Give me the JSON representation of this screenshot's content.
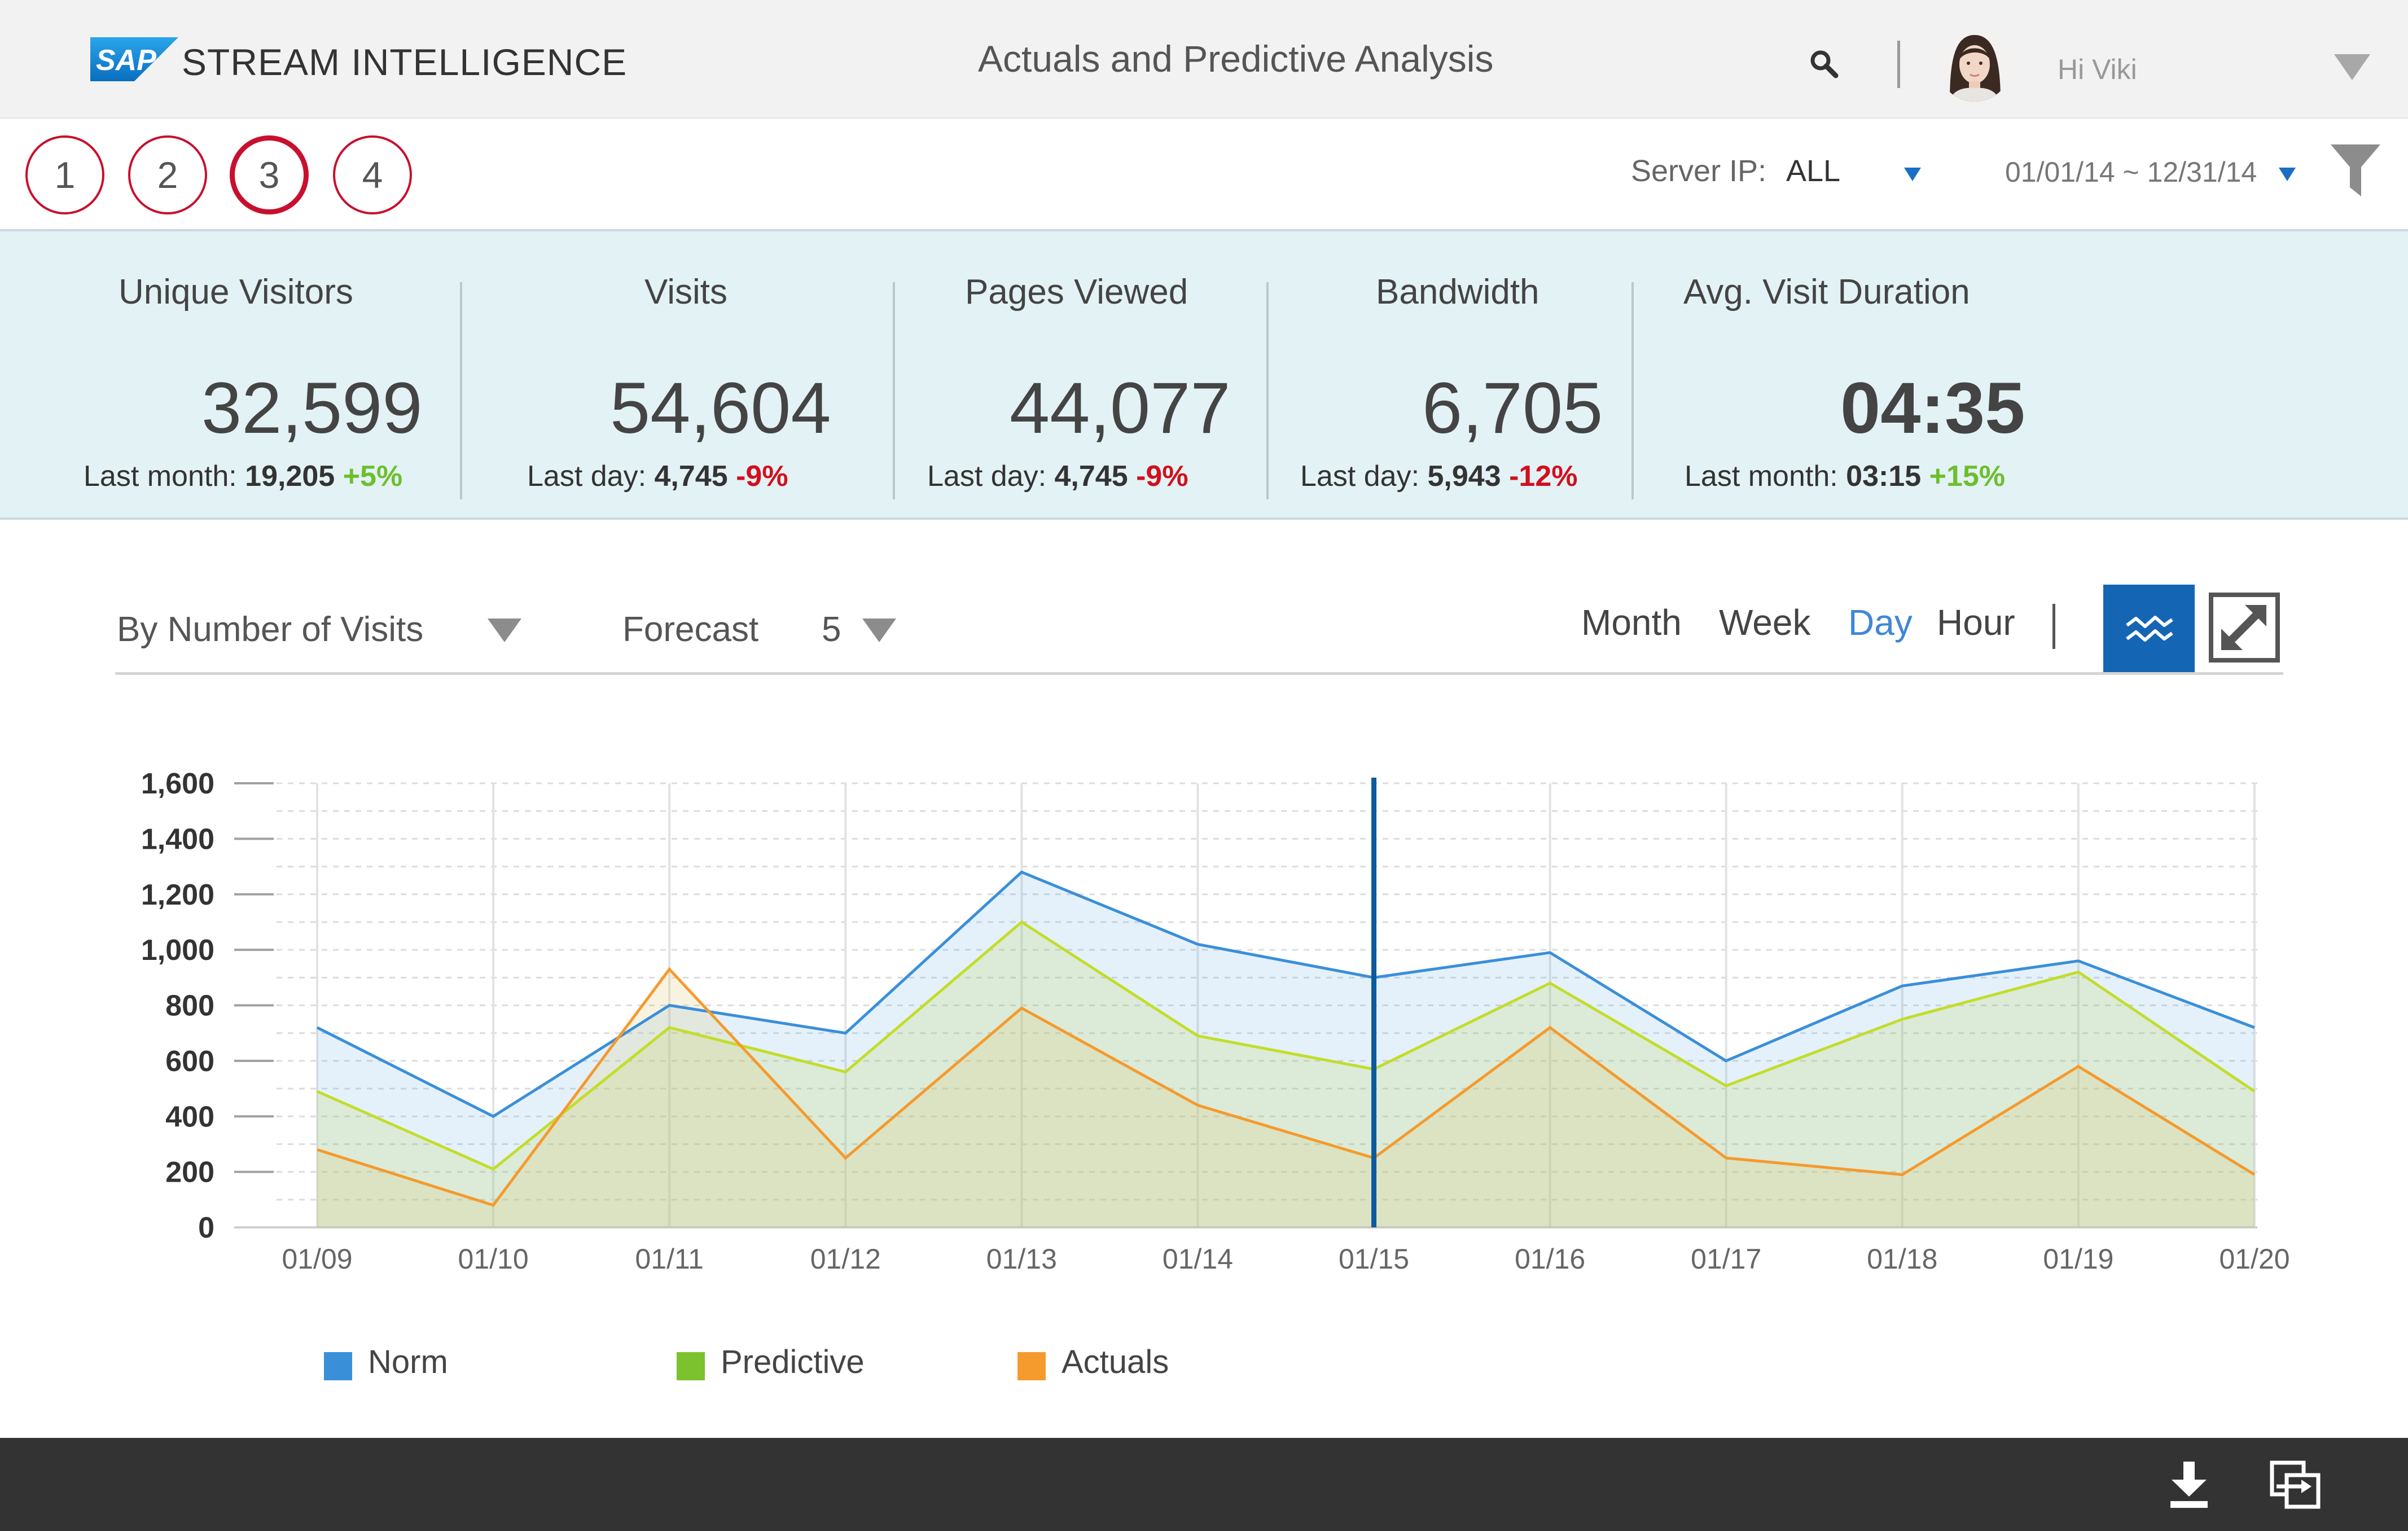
{
  "header": {
    "logo_text": "SAP",
    "brand": "STREAM INTELLIGENCE",
    "title": "Actuals and Predictive Analysis",
    "greeting": "Hi Viki"
  },
  "steps": [
    "1",
    "2",
    "3",
    "4"
  ],
  "active_step": "3",
  "filters": {
    "server_ip_label": "Server IP:",
    "server_ip_value": "ALL",
    "date_range": "01/01/14 ~ 12/31/14"
  },
  "kpis": [
    {
      "title": "Unique Visitors",
      "value": "32,599",
      "compare_label": "Last month:",
      "compare_value": "19,205",
      "delta": "+5%",
      "trend": "up"
    },
    {
      "title": "Visits",
      "value": "54,604",
      "compare_label": "Last day:",
      "compare_value": "4,745",
      "delta": "-9%",
      "trend": "down"
    },
    {
      "title": "Pages Viewed",
      "value": "44,077",
      "compare_label": "Last day:",
      "compare_value": "4,745",
      "delta": "-9%",
      "trend": "down"
    },
    {
      "title": "Bandwidth",
      "value": "6,705",
      "compare_label": "Last day:",
      "compare_value": "5,943",
      "delta": "-12%",
      "trend": "down"
    },
    {
      "title": "Avg. Visit Duration",
      "value": "04:35",
      "compare_label": "Last month:",
      "compare_value": "03:15",
      "delta": "+15%",
      "trend": "up"
    }
  ],
  "toolbar": {
    "measure": "By Number of Visits",
    "forecast_label": "Forecast",
    "forecast_value": "5",
    "granularity": [
      "Month",
      "Week",
      "Day",
      "Hour"
    ],
    "active_granularity": "Day"
  },
  "legend": [
    "Norm",
    "Predictive",
    "Actuals"
  ],
  "colors": {
    "norm": "#3a8fd9",
    "predictive": "#c3dd2a",
    "actuals": "#f59a2d",
    "step_ring": "#c8102e",
    "kpi_band": "#e3f2f4",
    "positive": "#6cbf2d",
    "negative": "#d0101e",
    "accent": "#1565b5",
    "footer": "#333333",
    "marker": "#0d5a9e"
  },
  "icons": {
    "search": "search-icon",
    "user_menu": "chevron-down-icon",
    "filter": "funnel-icon",
    "chart_type": "area-chart-icon",
    "expand": "expand-icon",
    "download": "download-icon",
    "export": "export-icon"
  },
  "chart_data": {
    "type": "area",
    "x": [
      "01/09",
      "01/10",
      "01/11",
      "01/12",
      "01/13",
      "01/14",
      "01/15",
      "01/16",
      "01/17",
      "01/18",
      "01/19",
      "01/20"
    ],
    "series": [
      {
        "name": "Norm",
        "values": [
          720,
          400,
          800,
          700,
          1280,
          1020,
          900,
          990,
          600,
          870,
          960,
          720
        ]
      },
      {
        "name": "Predictive",
        "values": [
          490,
          210,
          720,
          560,
          1100,
          690,
          570,
          880,
          510,
          750,
          920,
          490
        ]
      },
      {
        "name": "Actuals",
        "values": [
          280,
          80,
          930,
          250,
          790,
          440,
          250,
          720,
          250,
          190,
          580,
          190
        ]
      }
    ],
    "yticks": [
      "0",
      "200",
      "400",
      "600",
      "800",
      "1,000",
      "1,200",
      "1,400",
      "1,600"
    ],
    "ylim": [
      0,
      1600
    ],
    "grid": true,
    "marker_x": "01/15",
    "legend_position": "bottom-left",
    "xlabel": "",
    "ylabel": ""
  }
}
